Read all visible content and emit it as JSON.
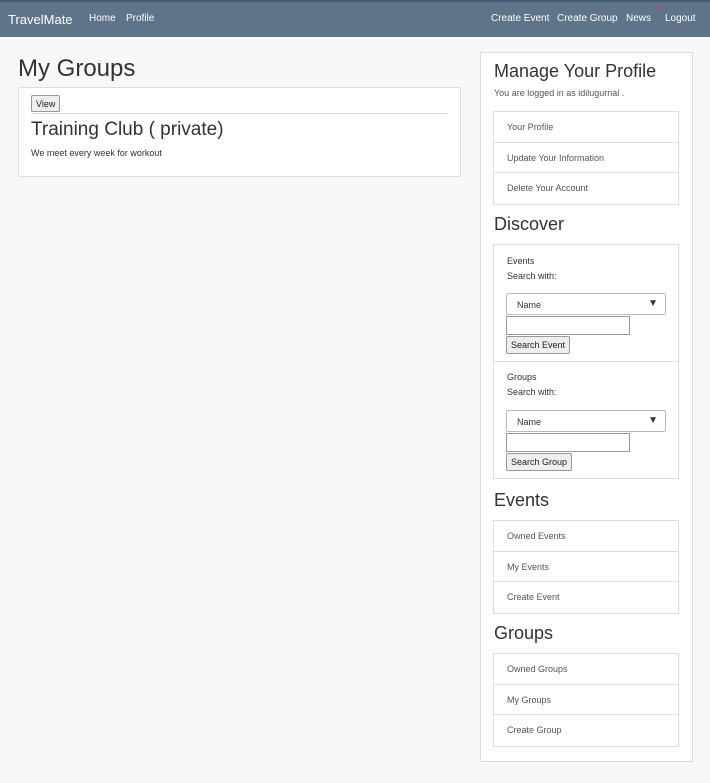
{
  "navbar": {
    "brand": "TravelMate",
    "left_links": [
      "Home",
      "Profile"
    ],
    "right_links": [
      "Create Event",
      "Create Group",
      "News",
      "Logout"
    ],
    "news_badge": "?"
  },
  "main": {
    "title": "My Groups",
    "group": {
      "view_label": "View",
      "name": "Training Club ( private)",
      "description": "We meet every week for workout"
    }
  },
  "sidebar": {
    "profile_heading": "Manage Your Profile",
    "logged_in_text": "You are logged in as idilugurnal .",
    "profile_items": [
      "Your Profile",
      "Update Your Information",
      "Delete Your Account"
    ],
    "discover_heading": "Discover",
    "discover": {
      "events": {
        "label": "Events",
        "search_with": "Search with:",
        "select_value": "Name",
        "button": "Search Event"
      },
      "groups": {
        "label": "Groups",
        "search_with": "Search with:",
        "select_value": "Name",
        "button": "Search Group"
      }
    },
    "events_heading": "Events",
    "events_items": [
      "Owned Events",
      "My Events",
      "Create Event"
    ],
    "groups_heading": "Groups",
    "groups_items": [
      "Owned Groups",
      "My Groups",
      "Create Group"
    ]
  }
}
